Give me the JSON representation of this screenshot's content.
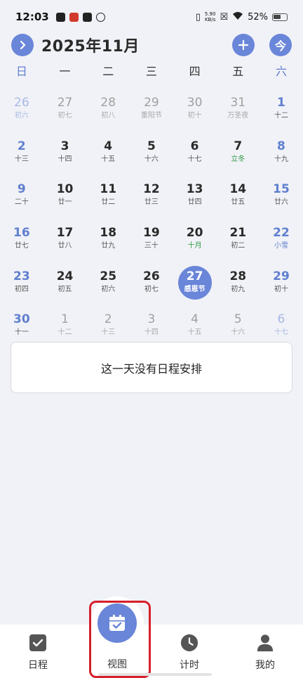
{
  "status_bar": {
    "time": "12:03",
    "speed_value": "5.90",
    "speed_unit": "KB/s",
    "battery": "52%"
  },
  "header": {
    "title": "2025年11月",
    "prev_glyph": ">",
    "add_glyph": "+",
    "today_glyph": "今"
  },
  "week_days": [
    "日",
    "一",
    "二",
    "三",
    "四",
    "五",
    "六"
  ],
  "days": [
    {
      "n": "26",
      "s": "初六",
      "other": true
    },
    {
      "n": "27",
      "s": "初七",
      "other": true
    },
    {
      "n": "28",
      "s": "初八",
      "other": true
    },
    {
      "n": "29",
      "s": "重阳节",
      "other": true,
      "fest": true
    },
    {
      "n": "30",
      "s": "初十",
      "other": true
    },
    {
      "n": "31",
      "s": "万圣夜",
      "other": true,
      "fest": true
    },
    {
      "n": "1",
      "s": "十二"
    },
    {
      "n": "2",
      "s": "十三"
    },
    {
      "n": "3",
      "s": "十四"
    },
    {
      "n": "4",
      "s": "十五"
    },
    {
      "n": "5",
      "s": "十六"
    },
    {
      "n": "6",
      "s": "十七"
    },
    {
      "n": "7",
      "s": "立冬",
      "term": true
    },
    {
      "n": "8",
      "s": "十九"
    },
    {
      "n": "9",
      "s": "二十"
    },
    {
      "n": "10",
      "s": "廿一"
    },
    {
      "n": "11",
      "s": "廿二"
    },
    {
      "n": "12",
      "s": "廿三"
    },
    {
      "n": "13",
      "s": "廿四"
    },
    {
      "n": "14",
      "s": "廿五"
    },
    {
      "n": "15",
      "s": "廿六"
    },
    {
      "n": "16",
      "s": "廿七"
    },
    {
      "n": "17",
      "s": "廿八"
    },
    {
      "n": "18",
      "s": "廿九"
    },
    {
      "n": "19",
      "s": "三十"
    },
    {
      "n": "20",
      "s": "十月",
      "term": true
    },
    {
      "n": "21",
      "s": "初二"
    },
    {
      "n": "22",
      "s": "小雪",
      "term": true
    },
    {
      "n": "23",
      "s": "初四"
    },
    {
      "n": "24",
      "s": "初五"
    },
    {
      "n": "25",
      "s": "初六"
    },
    {
      "n": "26",
      "s": "初七"
    },
    {
      "n": "27",
      "s": "感恩节",
      "today": true
    },
    {
      "n": "28",
      "s": "初九"
    },
    {
      "n": "29",
      "s": "初十"
    },
    {
      "n": "30",
      "s": "十一"
    },
    {
      "n": "1",
      "s": "十二",
      "other": true
    },
    {
      "n": "2",
      "s": "十三",
      "other": true
    },
    {
      "n": "3",
      "s": "十四",
      "other": true
    },
    {
      "n": "4",
      "s": "十五",
      "other": true
    },
    {
      "n": "5",
      "s": "十六",
      "other": true
    },
    {
      "n": "6",
      "s": "十七",
      "other": true
    }
  ],
  "empty_message": "这一天没有日程安排",
  "nav": {
    "schedule": "日程",
    "view": "视图",
    "timer": "计时",
    "mine": "我的"
  },
  "colors": {
    "accent": "#6a86d9",
    "term": "#2c9a42",
    "highlight": "#d6202a"
  },
  "icons": {
    "schedule": "checkbox-icon",
    "view": "calendar-check-icon",
    "timer": "clock-icon",
    "mine": "person-icon"
  }
}
